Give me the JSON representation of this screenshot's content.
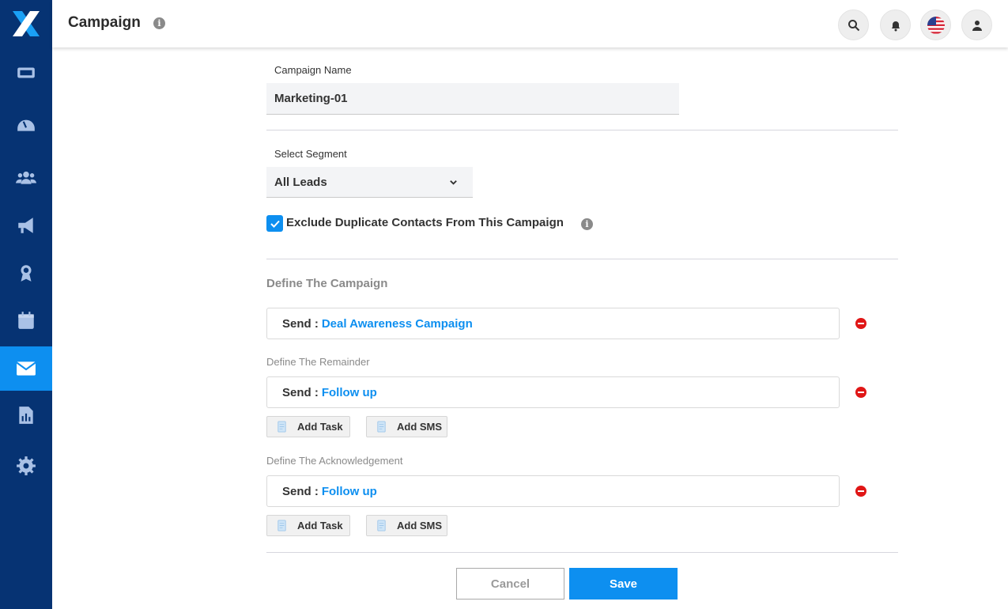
{
  "header": {
    "title": "Campaign",
    "title_info_icon": "info-icon",
    "actions": [
      "search-icon",
      "bell-icon",
      "us-flag-icon",
      "user-icon"
    ]
  },
  "sidebar": {
    "logo": "x-logo",
    "items": [
      {
        "icon": "ticket-icon",
        "active": false
      },
      {
        "icon": "dashboard-gauge-icon",
        "active": false
      },
      {
        "icon": "users-group-icon",
        "active": false
      },
      {
        "icon": "megaphone-icon",
        "active": false
      },
      {
        "icon": "award-icon",
        "active": false
      },
      {
        "icon": "calendar-icon",
        "active": false
      },
      {
        "icon": "envelope-icon",
        "active": true
      },
      {
        "icon": "report-chart-icon",
        "active": false
      },
      {
        "icon": "gear-icon",
        "active": false
      }
    ]
  },
  "form": {
    "campaign_name_label": "Campaign Name",
    "campaign_name_value": "Marketing-01",
    "segment_label": "Select Segment",
    "segment_value": "All Leads",
    "exclude_label": "Exclude Duplicate Contacts From This Campaign",
    "exclude_checked": true,
    "define_title": "Define The Campaign",
    "campaign_send_prefix": "Send :",
    "campaign_send_value": "Deal Awareness Campaign",
    "remainder_label": "Define The Remainder",
    "remainder_send_prefix": "Send :",
    "remainder_send_value": "Follow up",
    "ack_label": "Define The Acknowledgement",
    "ack_send_prefix": "Send :",
    "ack_send_value": "Follow up",
    "add_task_label": "Add Task",
    "add_sms_label": "Add SMS",
    "cancel_label": "Cancel",
    "save_label": "Save"
  },
  "colors": {
    "sidebar_bg": "#063373",
    "accent": "#0d8ff0",
    "remove": "#e01616"
  }
}
